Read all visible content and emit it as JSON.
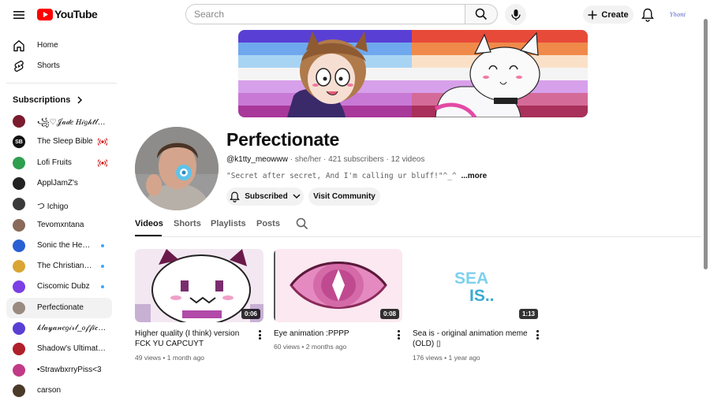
{
  "header": {
    "logo_text": "YouTube",
    "search_placeholder": "Search",
    "create_label": "Create",
    "account_avatar_text": "Yhoni"
  },
  "sidebar": {
    "main_items": [
      {
        "label": "Home",
        "icon": "home-icon"
      },
      {
        "label": "Shorts",
        "icon": "shorts-icon"
      }
    ],
    "subscriptions_title": "Subscriptions",
    "subscriptions": [
      {
        "label": "꧁♡𝒥𝒶𝒹𝑒 𝐻𝒾𝑔𝒽𝓉𝓁𝓉…",
        "indicator": "none",
        "avatar_color": "#7a1b2e"
      },
      {
        "label": "The Sleep Bible",
        "indicator": "live",
        "avatar_color": "#111111",
        "avatar_text": "SB"
      },
      {
        "label": "Lofi Fruits",
        "indicator": "live",
        "avatar_color": "#2e9e4f"
      },
      {
        "label": "ApplJamZ's",
        "indicator": "none",
        "avatar_color": "#222222"
      },
      {
        "label": "つ Ichigo",
        "indicator": "none",
        "avatar_color": "#3a3a3a"
      },
      {
        "label": "Tevomxntana",
        "indicator": "none",
        "avatar_color": "#8a6a5a"
      },
      {
        "label": "Sonic the Hedgehog",
        "indicator": "new",
        "avatar_color": "#2a5fd4"
      },
      {
        "label": "The Christian Gr…",
        "indicator": "new",
        "avatar_color": "#d9a533"
      },
      {
        "label": "Ciscomic Dubz",
        "indicator": "new",
        "avatar_color": "#7b3fe4"
      },
      {
        "label": "Perfectionate",
        "indicator": "none",
        "avatar_color": "#9a8a80",
        "active": true
      },
      {
        "label": "𝓀𝓁𝒶𝓎𝒶𝓃𝑒𝑔𝒾𝓇𝓁_𝑜𝒻𝒻𝒾𝒸𝒾𝒶𝓁…",
        "indicator": "none",
        "avatar_color": "#5a3fd4"
      },
      {
        "label": "Shadow's Ultimate…",
        "indicator": "none",
        "avatar_color": "#b0202a"
      },
      {
        "label": "•StrawbxrryPiss<3",
        "indicator": "none",
        "avatar_color": "#c23a86"
      },
      {
        "label": "carson",
        "indicator": "none",
        "avatar_color": "#4a3a2a"
      }
    ]
  },
  "channel": {
    "name": "Perfectionate",
    "handle": "@k1tty_meowww",
    "meta_rest": " · she/her · 421 subscribers · 12 videos",
    "description": "\"Secret after secret, And I'm calling ur bluff!\"^_^",
    "more_label": "...more",
    "subscribed_label": "Subscribed",
    "community_label": "Visit Community"
  },
  "tabs": [
    "Videos",
    "Shorts",
    "Playlists",
    "Posts"
  ],
  "active_tab": "Videos",
  "videos": [
    {
      "title": "Higher quality (I think) version FCK YU CAPCUYT",
      "meta": "49 views • 1 month ago",
      "duration": "0:06"
    },
    {
      "title": "Eye animation :PPPP",
      "meta": "60 views • 2 months ago",
      "duration": "0:08"
    },
    {
      "title": "Sea is - original animation meme (OLD) ▯",
      "meta": "176 views • 1 year ago",
      "duration": "1:13"
    }
  ],
  "colors": {
    "brand_red": "#ff0000",
    "live_red": "#cc0000",
    "new_dot": "#3ea6ff"
  }
}
